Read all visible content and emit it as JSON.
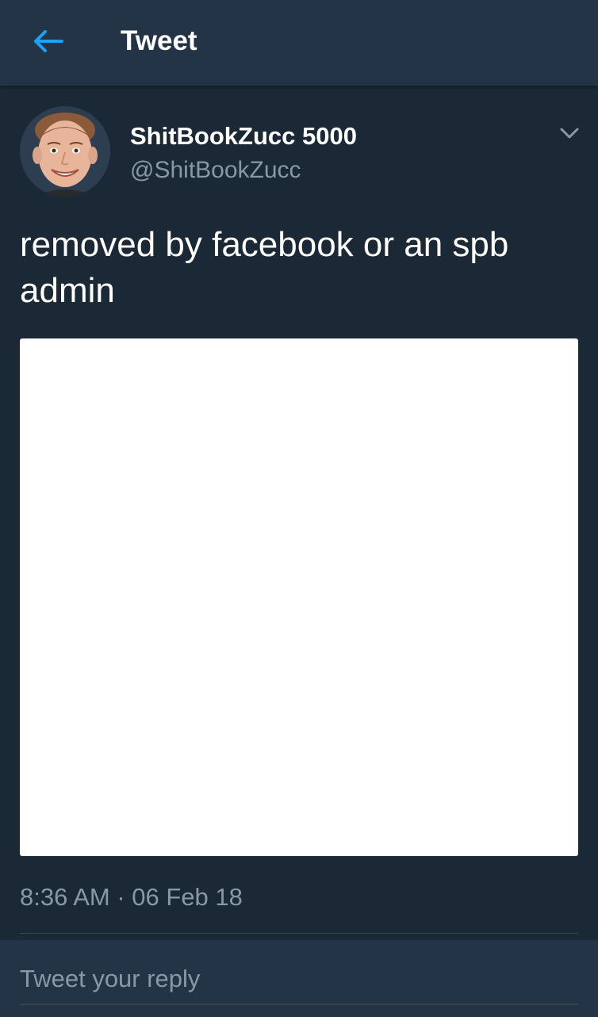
{
  "topbar": {
    "title": "Tweet",
    "back_icon": "arrow-left-icon",
    "accent_color": "#1da1f2"
  },
  "tweet": {
    "display_name": "ShitBookZucc 5000",
    "handle": "@ShitBookZucc",
    "text": "removed by facebook or an spb admin",
    "timestamp": "8:36 AM · 06 Feb 18",
    "menu_icon": "chevron-down-icon",
    "avatar_icon": "avatar"
  },
  "reply": {
    "placeholder": "Tweet your reply"
  },
  "colors": {
    "background": "#1b2836",
    "bar": "#243447",
    "secondary_text": "#8899a6"
  }
}
